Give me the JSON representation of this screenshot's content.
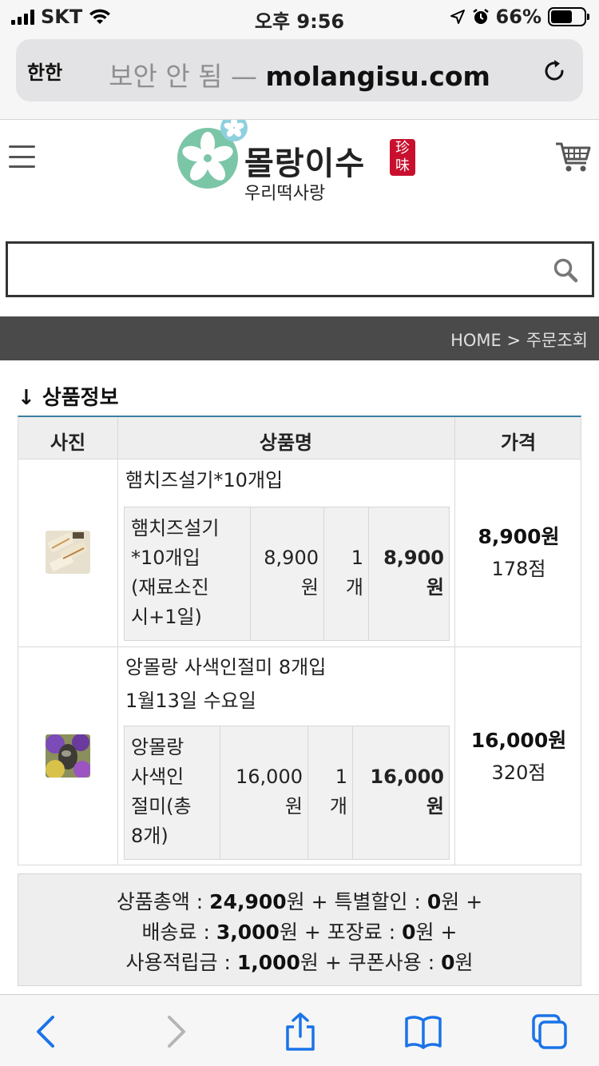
{
  "status": {
    "carrier": "SKT",
    "time": "오후 9:56",
    "battery": "66%",
    "battery_level": 0.66
  },
  "browser": {
    "aa": "한한",
    "insecure": "보안 안 됨 —",
    "domain": "molangisu.com"
  },
  "site": {
    "logo_name": "몰랑이수",
    "logo_sub": "우리떡사랑",
    "logo_seal": "珍味"
  },
  "search": {
    "value": "",
    "placeholder": ""
  },
  "breadcrumb": "HOME > 주문조회",
  "section_title": "↓ 상품정보",
  "table": {
    "headers": [
      "사진",
      "상품명",
      "가격"
    ],
    "items": [
      {
        "name_lines": [
          "햄치즈설기*10개입"
        ],
        "option_lines": [
          "햄치즈설기",
          "*10개입",
          "(재료소진",
          "시+1일)"
        ],
        "unit_price_lines": [
          "8,900",
          "원"
        ],
        "qty_lines": [
          "1",
          "개"
        ],
        "subtotal_lines": [
          "8,900",
          "원"
        ],
        "price": "8,900원",
        "points": "178점"
      },
      {
        "name_lines": [
          "앙몰랑 사색인절미 8개입",
          "1월13일 수요일"
        ],
        "option_lines": [
          "앙몰랑",
          "사색인",
          "절미(총",
          "8개)"
        ],
        "unit_price_lines": [
          "16,000",
          "원"
        ],
        "qty_lines": [
          "1",
          "개"
        ],
        "subtotal_lines": [
          "16,000",
          "원"
        ],
        "price": "16,000원",
        "points": "320점"
      }
    ]
  },
  "summary": {
    "goods_label": "상품총액 :",
    "goods_value": "24,900",
    "won": "원",
    "discount_label": "+ 특별할인 :",
    "discount_value": "0",
    "discount_tail": "원 +",
    "shipping_label": "배송료 :",
    "shipping_value": "3,000",
    "packing_label": "원 + 포장료 :",
    "packing_value": "0",
    "packing_tail": "원 +",
    "points_label": "사용적립금 :",
    "points_value": "1,000",
    "coupon_label": "원 + 쿠폰사용 :",
    "coupon_value": "0",
    "coupon_tail": "원"
  },
  "colors": {
    "accent": "#3a7fa0",
    "safari_blue": "#1a73e8",
    "seal_red": "#c8102e",
    "logo_green": "#7cc6a8",
    "dark_bar": "#4a4a4a"
  }
}
